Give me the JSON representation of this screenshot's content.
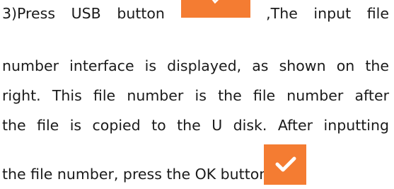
{
  "content": {
    "step_prefix": "3)Press",
    "usb_word": "USB",
    "button_word": "button",
    "after_usb_icon": ",The",
    "input_word": "input",
    "file_word": "file",
    "line2": "number interface is displayed, as shown on the",
    "line3": "right. This file number is the file number after",
    "line4": "the file is copied to the U disk. After inputting",
    "line5": "the file number, press the OK button.",
    "usb_icon": "orange-usb-button-icon",
    "ok_icon": "orange-checkmark-ok-icon",
    "accent_color": "#f47c32",
    "check_color": "#ffffff"
  }
}
